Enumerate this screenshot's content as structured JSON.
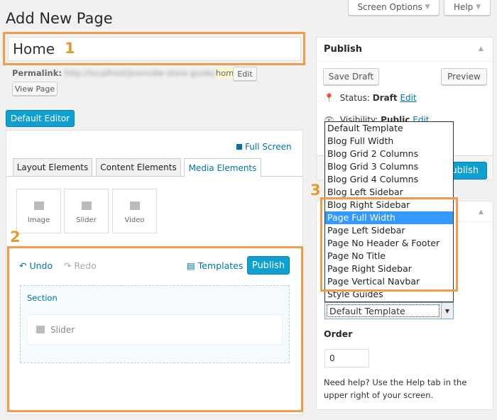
{
  "page_title": "Add New Page",
  "top": {
    "screen_options": "Screen Options",
    "help": "Help"
  },
  "title_input": {
    "value": "Home"
  },
  "callouts": [
    "1",
    "2",
    "3"
  ],
  "permalink": {
    "label": "Permalink:",
    "url": "http://localhost/joom/dw-store-guide/",
    "slug": "home",
    "trail": "/",
    "edit": "Edit",
    "view_page": "View Page"
  },
  "default_editor": "Default Editor",
  "builder": {
    "full_screen": "Full Screen",
    "tabs": [
      "Layout Elements",
      "Content Elements",
      "Media Elements"
    ],
    "items": [
      {
        "label": "Image",
        "icon": "image-icon"
      },
      {
        "label": "Slider",
        "icon": "slider-icon"
      },
      {
        "label": "Video",
        "icon": "video-icon"
      }
    ],
    "undo": "Undo",
    "redo": "Redo",
    "templates": "Templates",
    "publish": "Publish",
    "section": "Section",
    "slider": "Slider"
  },
  "publish_box": {
    "title": "Publish",
    "save_draft": "Save Draft",
    "preview": "Preview",
    "status_label": "Status:",
    "status": "Draft",
    "edit": "Edit",
    "visibility_label": "Visibility:",
    "visibility": "Public",
    "publish": "Publish"
  },
  "template_dropdown": {
    "options": [
      "Default Template",
      "Blog Full Width",
      "Blog Grid 2 Columns",
      "Blog Grid 3 Columns",
      "Blog Grid 4 Columns",
      "Blog Left Sidebar",
      "Blog Right Sidebar",
      "Page Full Width",
      "Page Left Sidebar",
      "Page No Header & Footer",
      "Page No Title",
      "Page Right Sidebar",
      "Page Vertical Navbar",
      "Style Guides"
    ],
    "highlighted": "Page Full Width",
    "selected": "Default Template"
  },
  "attributes": {
    "order_label": "Order",
    "order_value": "0",
    "help": "Need help? Use the Help tab in the upper right of your screen."
  },
  "colors": {
    "accent": "#0ea0d3",
    "callout": "#f39a4b",
    "highlight": "#3399ff"
  }
}
